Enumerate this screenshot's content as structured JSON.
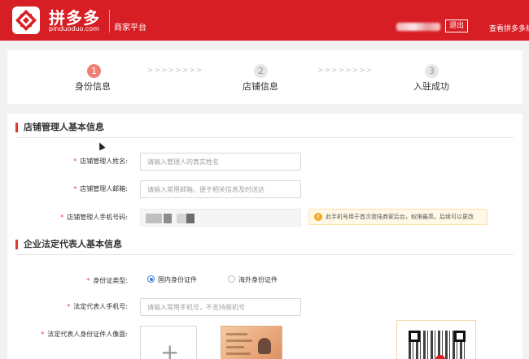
{
  "header": {
    "brand": "拼多多",
    "brand_sub": "pinduoduo.com",
    "platform": "商家平台",
    "logout_label": "退出",
    "view_link": "查看拼多多规",
    "logo_icon": "pinduoduo-logo-icon",
    "bg_color": "#d81e25"
  },
  "steps": [
    {
      "number": "1",
      "label": "身份信息",
      "state": "active"
    },
    {
      "number": "2",
      "label": "店铺信息",
      "state": "idle"
    },
    {
      "number": "3",
      "label": "入驻成功",
      "state": "idle"
    }
  ],
  "step_separator": ">>>>>>>>",
  "section_manager": {
    "title": "店铺管理人基本信息",
    "name_label": "店铺管理人姓名:",
    "name_placeholder": "请输入管理人的真实姓名",
    "email_label": "店铺管理人邮箱:",
    "email_placeholder": "请输入常用邮箱，便于相关信息及时送达",
    "phone_label": "店铺管理人手机号码:",
    "phone_tip": "此手机号用于首次登陆商家后台，权限最高，后续可以更改"
  },
  "section_legal": {
    "title": "企业法定代表人基本信息",
    "id_type_label": "身份证类型:",
    "id_type_options": [
      "国内身份证件",
      "海外身份证件"
    ],
    "id_type_selected": "国内身份证件",
    "phone_label": "法定代表人手机号:",
    "phone_placeholder": "请输入常用手机号，不支持座机号",
    "id_photo_label": "法定代表人身份证件人像面:",
    "upload_symbol": "+"
  },
  "required_mark": "*"
}
